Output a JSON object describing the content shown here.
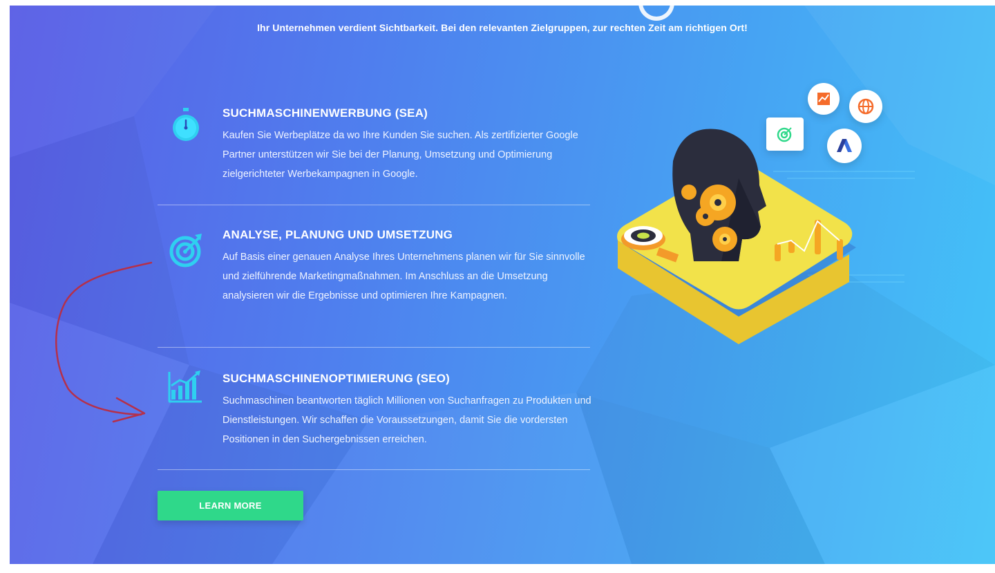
{
  "header": {
    "subtitle": "Ihr Unternehmen verdient Sichtbarkeit. Bei den relevanten Zielgruppen, zur rechten Zeit am richtigen Ort!"
  },
  "features": [
    {
      "icon": "stopwatch-icon",
      "title": "SUCHMASCHINENWERBUNG (SEA)",
      "text": "Kaufen Sie Werbeplätze da wo Ihre Kunden Sie suchen. Als zertifizierter Google Partner unterstützen wir Sie bei der Planung, Umsetzung und Optimierung zielgerichteter Werbekampagnen in Google."
    },
    {
      "icon": "target-icon",
      "title": "ANALYSE, PLANUNG UND UMSETZUNG",
      "text": "Auf Basis einer genauen Analyse Ihres Unternehmens planen wir für Sie sinnvolle und zielführende Marketingmaßnahmen. Im Anschluss an die Umsetzung analysieren wir die Ergebnisse und optimieren Ihre Kampagnen."
    },
    {
      "icon": "bar-chart-icon",
      "title": "SUCHMASCHINENOPTIMIERUNG (SEO)",
      "text": "Suchmaschinen beantworten täglich Millionen von Suchanfragen zu Produkten und Dienstleistungen. Wir schaffen die Voraussetzungen, damit Sie die vordersten Positionen in den Suchergebnissen erreichen."
    }
  ],
  "cta": {
    "label": "LEARN MORE"
  },
  "colors": {
    "accent_cyan": "#2fd0f0",
    "button_green": "#2fd88a",
    "annotation_red": "#b5304a",
    "platform_yellow": "#f2e24a"
  },
  "illustration": {
    "icons": [
      "analytics-icon",
      "globe-icon",
      "target-bubble-icon",
      "adwords-icon",
      "gear-head-icon",
      "magnifier-icon"
    ]
  }
}
